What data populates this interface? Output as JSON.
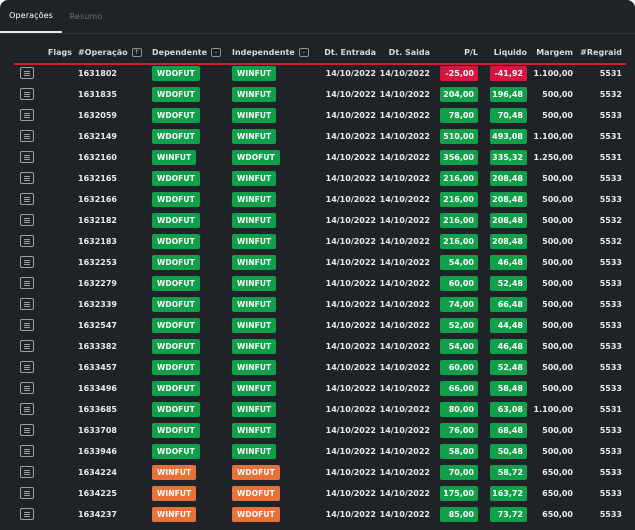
{
  "tabs": [
    {
      "label": "Operações",
      "active": true
    },
    {
      "label": "Resumo",
      "active": false
    }
  ],
  "colors": {
    "background": "#1f2327",
    "green": "#10a04a",
    "orange": "#e8713a",
    "red": "#d8143f",
    "header_line": "#c8222f"
  },
  "table": {
    "headers": {
      "flags": "Flags",
      "operacao": "#Operação",
      "dependente": "Dependente",
      "independente": "Independente",
      "entrada": "Dt. Entrada",
      "saida": "Dt. Saida",
      "pl": "P/L",
      "liquido": "Liquido",
      "margem": "Margem",
      "regra": "#Regraid"
    },
    "sort_icons": {
      "operacao": "↑",
      "dependente": "-",
      "independente": "-"
    },
    "rows": [
      {
        "op": "1631802",
        "dep": "WDOFUT",
        "ind": "WINFUT",
        "ent": "14/10/2022",
        "sai": "14/10/2022",
        "pl": "-25,00",
        "liq": "-41,92",
        "margem": "1.100,00",
        "regra": "5531",
        "dep_color": "#10a04a",
        "ind_color": "#10a04a",
        "pl_color": "#d8143f",
        "liq_color": "#d8143f"
      },
      {
        "op": "1631835",
        "dep": "WDOFUT",
        "ind": "WINFUT",
        "ent": "14/10/2022",
        "sai": "14/10/2022",
        "pl": "204,00",
        "liq": "196,48",
        "margem": "500,00",
        "regra": "5532",
        "dep_color": "#10a04a",
        "ind_color": "#10a04a",
        "pl_color": "#10a04a",
        "liq_color": "#10a04a"
      },
      {
        "op": "1632059",
        "dep": "WDOFUT",
        "ind": "WINFUT",
        "ent": "14/10/2022",
        "sai": "14/10/2022",
        "pl": "78,00",
        "liq": "70,48",
        "margem": "500,00",
        "regra": "5533",
        "dep_color": "#10a04a",
        "ind_color": "#10a04a",
        "pl_color": "#10a04a",
        "liq_color": "#10a04a"
      },
      {
        "op": "1632149",
        "dep": "WDOFUT",
        "ind": "WINFUT",
        "ent": "14/10/2022",
        "sai": "14/10/2022",
        "pl": "510,00",
        "liq": "493,08",
        "margem": "1.100,00",
        "regra": "5531",
        "dep_color": "#10a04a",
        "ind_color": "#10a04a",
        "pl_color": "#10a04a",
        "liq_color": "#10a04a"
      },
      {
        "op": "1632160",
        "dep": "WINFUT",
        "ind": "WDOFUT",
        "ent": "14/10/2022",
        "sai": "14/10/2022",
        "pl": "356,00",
        "liq": "335,32",
        "margem": "1.250,00",
        "regra": "5531",
        "dep_color": "#10a04a",
        "ind_color": "#10a04a",
        "pl_color": "#10a04a",
        "liq_color": "#10a04a"
      },
      {
        "op": "1632165",
        "dep": "WDOFUT",
        "ind": "WINFUT",
        "ent": "14/10/2022",
        "sai": "14/10/2022",
        "pl": "216,00",
        "liq": "208,48",
        "margem": "500,00",
        "regra": "5533",
        "dep_color": "#10a04a",
        "ind_color": "#10a04a",
        "pl_color": "#10a04a",
        "liq_color": "#10a04a"
      },
      {
        "op": "1632166",
        "dep": "WDOFUT",
        "ind": "WINFUT",
        "ent": "14/10/2022",
        "sai": "14/10/2022",
        "pl": "216,00",
        "liq": "208,48",
        "margem": "500,00",
        "regra": "5533",
        "dep_color": "#10a04a",
        "ind_color": "#10a04a",
        "pl_color": "#10a04a",
        "liq_color": "#10a04a"
      },
      {
        "op": "1632182",
        "dep": "WDOFUT",
        "ind": "WINFUT",
        "ent": "14/10/2022",
        "sai": "14/10/2022",
        "pl": "216,00",
        "liq": "208,48",
        "margem": "500,00",
        "regra": "5532",
        "dep_color": "#10a04a",
        "ind_color": "#10a04a",
        "pl_color": "#10a04a",
        "liq_color": "#10a04a"
      },
      {
        "op": "1632183",
        "dep": "WDOFUT",
        "ind": "WINFUT",
        "ent": "14/10/2022",
        "sai": "14/10/2022",
        "pl": "216,00",
        "liq": "208,48",
        "margem": "500,00",
        "regra": "5532",
        "dep_color": "#10a04a",
        "ind_color": "#10a04a",
        "pl_color": "#10a04a",
        "liq_color": "#10a04a"
      },
      {
        "op": "1632253",
        "dep": "WDOFUT",
        "ind": "WINFUT",
        "ent": "14/10/2022",
        "sai": "14/10/2022",
        "pl": "54,00",
        "liq": "46,48",
        "margem": "500,00",
        "regra": "5533",
        "dep_color": "#10a04a",
        "ind_color": "#10a04a",
        "pl_color": "#10a04a",
        "liq_color": "#10a04a"
      },
      {
        "op": "1632279",
        "dep": "WDOFUT",
        "ind": "WINFUT",
        "ent": "14/10/2022",
        "sai": "14/10/2022",
        "pl": "60,00",
        "liq": "52,48",
        "margem": "500,00",
        "regra": "5533",
        "dep_color": "#10a04a",
        "ind_color": "#10a04a",
        "pl_color": "#10a04a",
        "liq_color": "#10a04a"
      },
      {
        "op": "1632339",
        "dep": "WDOFUT",
        "ind": "WINFUT",
        "ent": "14/10/2022",
        "sai": "14/10/2022",
        "pl": "74,00",
        "liq": "66,48",
        "margem": "500,00",
        "regra": "5533",
        "dep_color": "#10a04a",
        "ind_color": "#10a04a",
        "pl_color": "#10a04a",
        "liq_color": "#10a04a"
      },
      {
        "op": "1632547",
        "dep": "WDOFUT",
        "ind": "WINFUT",
        "ent": "14/10/2022",
        "sai": "14/10/2022",
        "pl": "52,00",
        "liq": "44,48",
        "margem": "500,00",
        "regra": "5533",
        "dep_color": "#10a04a",
        "ind_color": "#10a04a",
        "pl_color": "#10a04a",
        "liq_color": "#10a04a"
      },
      {
        "op": "1633382",
        "dep": "WDOFUT",
        "ind": "WINFUT",
        "ent": "14/10/2022",
        "sai": "14/10/2022",
        "pl": "54,00",
        "liq": "46,48",
        "margem": "500,00",
        "regra": "5533",
        "dep_color": "#10a04a",
        "ind_color": "#10a04a",
        "pl_color": "#10a04a",
        "liq_color": "#10a04a"
      },
      {
        "op": "1633457",
        "dep": "WDOFUT",
        "ind": "WINFUT",
        "ent": "14/10/2022",
        "sai": "14/10/2022",
        "pl": "60,00",
        "liq": "52,48",
        "margem": "500,00",
        "regra": "5533",
        "dep_color": "#10a04a",
        "ind_color": "#10a04a",
        "pl_color": "#10a04a",
        "liq_color": "#10a04a"
      },
      {
        "op": "1633496",
        "dep": "WDOFUT",
        "ind": "WINFUT",
        "ent": "14/10/2022",
        "sai": "14/10/2022",
        "pl": "66,00",
        "liq": "58,48",
        "margem": "500,00",
        "regra": "5533",
        "dep_color": "#10a04a",
        "ind_color": "#10a04a",
        "pl_color": "#10a04a",
        "liq_color": "#10a04a"
      },
      {
        "op": "1633685",
        "dep": "WDOFUT",
        "ind": "WINFUT",
        "ent": "14/10/2022",
        "sai": "14/10/2022",
        "pl": "80,00",
        "liq": "63,08",
        "margem": "1.100,00",
        "regra": "5531",
        "dep_color": "#10a04a",
        "ind_color": "#10a04a",
        "pl_color": "#10a04a",
        "liq_color": "#10a04a"
      },
      {
        "op": "1633708",
        "dep": "WDOFUT",
        "ind": "WINFUT",
        "ent": "14/10/2022",
        "sai": "14/10/2022",
        "pl": "76,00",
        "liq": "68,48",
        "margem": "500,00",
        "regra": "5533",
        "dep_color": "#10a04a",
        "ind_color": "#10a04a",
        "pl_color": "#10a04a",
        "liq_color": "#10a04a"
      },
      {
        "op": "1633946",
        "dep": "WDOFUT",
        "ind": "WINFUT",
        "ent": "14/10/2022",
        "sai": "14/10/2022",
        "pl": "58,00",
        "liq": "50,48",
        "margem": "500,00",
        "regra": "5533",
        "dep_color": "#10a04a",
        "ind_color": "#10a04a",
        "pl_color": "#10a04a",
        "liq_color": "#10a04a"
      },
      {
        "op": "1634224",
        "dep": "WINFUT",
        "ind": "WDOFUT",
        "ent": "14/10/2022",
        "sai": "14/10/2022",
        "pl": "70,00",
        "liq": "58,72",
        "margem": "650,00",
        "regra": "5533",
        "dep_color": "#e8713a",
        "ind_color": "#e8713a",
        "pl_color": "#10a04a",
        "liq_color": "#10a04a"
      },
      {
        "op": "1634225",
        "dep": "WINFUT",
        "ind": "WDOFUT",
        "ent": "14/10/2022",
        "sai": "14/10/2022",
        "pl": "175,00",
        "liq": "163,72",
        "margem": "650,00",
        "regra": "5533",
        "dep_color": "#e8713a",
        "ind_color": "#e8713a",
        "pl_color": "#10a04a",
        "liq_color": "#10a04a"
      },
      {
        "op": "1634237",
        "dep": "WINFUT",
        "ind": "WDOFUT",
        "ent": "14/10/2022",
        "sai": "14/10/2022",
        "pl": "85,00",
        "liq": "73,72",
        "margem": "650,00",
        "regra": "5533",
        "dep_color": "#e8713a",
        "ind_color": "#e8713a",
        "pl_color": "#10a04a",
        "liq_color": "#10a04a"
      }
    ]
  }
}
